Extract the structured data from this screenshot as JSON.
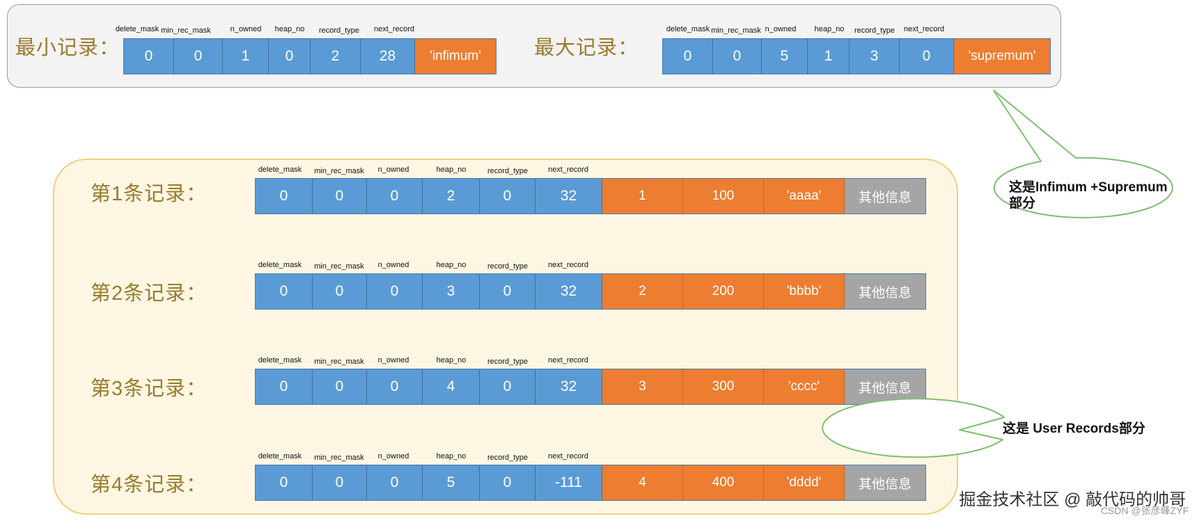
{
  "field_labels": [
    "delete_mask",
    "min_rec_mask",
    "n_owned",
    "heap_no",
    "record_type",
    "next_record"
  ],
  "infimum": {
    "label": "最小记录：",
    "values": [
      "0",
      "0",
      "1",
      "0",
      "2",
      "28"
    ],
    "data": "'infimum'"
  },
  "supremum": {
    "label": "最大记录：",
    "values": [
      "0",
      "0",
      "5",
      "1",
      "3",
      "0"
    ],
    "data": "'supremum'"
  },
  "records": [
    {
      "label": "第1条记录：",
      "values": [
        "0",
        "0",
        "0",
        "2",
        "0",
        "32"
      ],
      "data": [
        "1",
        "100",
        "'aaaa'"
      ],
      "other": "其他信息"
    },
    {
      "label": "第2条记录：",
      "values": [
        "0",
        "0",
        "0",
        "3",
        "0",
        "32"
      ],
      "data": [
        "2",
        "200",
        "'bbbb'"
      ],
      "other": "其他信息"
    },
    {
      "label": "第3条记录：",
      "values": [
        "0",
        "0",
        "0",
        "4",
        "0",
        "32"
      ],
      "data": [
        "3",
        "300",
        "'cccc'"
      ],
      "other": "其他信息"
    },
    {
      "label": "第4条记录：",
      "values": [
        "0",
        "0",
        "0",
        "5",
        "0",
        "-111"
      ],
      "data": [
        "4",
        "400",
        "'dddd'"
      ],
      "other": "其他信息"
    }
  ],
  "callouts": {
    "infimum_supremum": {
      "line1": "这是Infimum +Supremum",
      "line2": "部分"
    },
    "user_records": {
      "text": "这是 User Records部分"
    }
  },
  "watermark": {
    "main": "掘金技术社区 @ 敲代码的帅哥",
    "sub": "CSDN @张彦峰ZYF"
  },
  "colors": {
    "header_blue": "#5b9bd5",
    "data_orange": "#ed7d31",
    "other_gray": "#a5a5a5",
    "panel_border_yellow": "#f2cf7a",
    "callout_green": "#7dbf6e"
  }
}
